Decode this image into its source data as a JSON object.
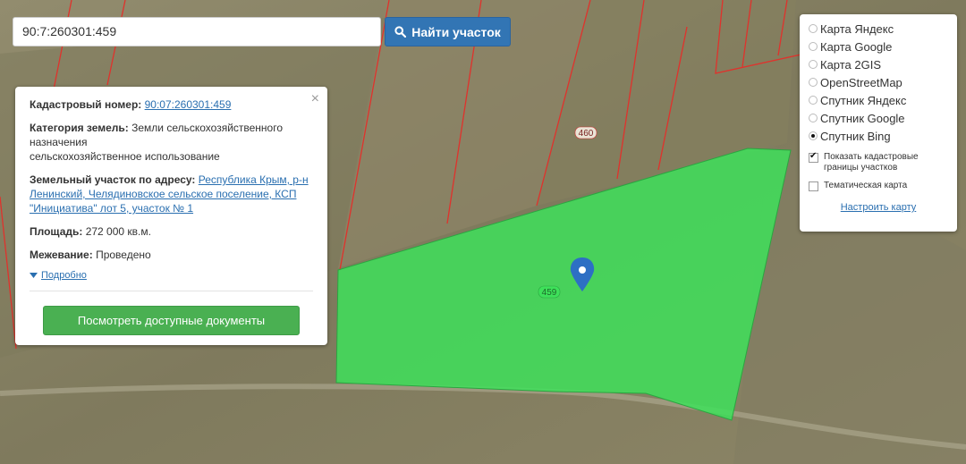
{
  "search": {
    "value": "90:7:260301:459",
    "button_label": "Найти участок",
    "button_icon": "search-icon"
  },
  "info": {
    "cadastral_label": "Кадастровый номер:",
    "cadastral_value": "90:07:260301:459",
    "category_label": "Категория земель:",
    "category_value_line1": "Земли сельскохозяйственного",
    "category_value_line2": "назначения",
    "category_value_line3": "сельскохозяйственное использование",
    "address_label": "Земельный участок по адресу:",
    "address_value": "Республика Крым, р-н Ленинский, Челядиновское сельское поселение, КСП \"Инициатива\" лот 5, участок № 1",
    "area_label": "Площадь:",
    "area_value": "272 000 кв.м.",
    "survey_label": "Межевание:",
    "survey_value": "Проведено",
    "more_label": "Подробно",
    "docs_button_label": "Посмотреть доступные документы",
    "close_icon": "close-icon"
  },
  "layers": {
    "options": [
      {
        "label": "Карта Яндекс",
        "selected": false
      },
      {
        "label": "Карта Google",
        "selected": false
      },
      {
        "label": "Карта 2GIS",
        "selected": false
      },
      {
        "label": "OpenStreetMap",
        "selected": false
      },
      {
        "label": "Спутник Яндекс",
        "selected": false
      },
      {
        "label": "Спутник Google",
        "selected": false
      },
      {
        "label": "Спутник Bing",
        "selected": true
      }
    ],
    "show_borders_label": "Показать кадастровые границы участков",
    "show_borders_checked": true,
    "thematic_label": "Тематическая карта",
    "thematic_checked": false,
    "setup_label": "Настроить карту"
  },
  "map": {
    "parcel_label_main": "459",
    "parcel_label_other": "460",
    "parcel_fill": "#3ee05a",
    "boundary_color": "#e0322c",
    "marker_color": "#2d6fc4"
  }
}
